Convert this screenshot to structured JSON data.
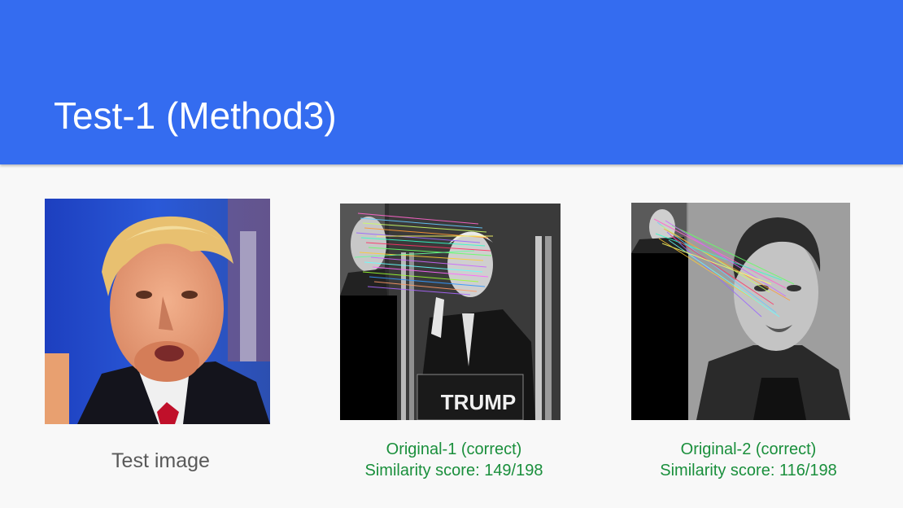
{
  "slide": {
    "title": "Test-1 (Method3)"
  },
  "images": {
    "test": {
      "caption": "Test image",
      "icon": "portrait-photo"
    },
    "original1": {
      "caption_line1": "Original-1 (correct)",
      "caption_line2": "Similarity score: 149/198",
      "icon": "keypoint-match-photo",
      "sign_text": "TRUMP"
    },
    "original2": {
      "caption_line1": "Original-2 (correct)",
      "caption_line2": "Similarity score: 116/198",
      "icon": "keypoint-match-photo"
    }
  },
  "colors": {
    "header": "#346cf0",
    "caption_green": "#1a8f3c",
    "caption_gray": "#595959",
    "background": "#f8f8f8"
  }
}
